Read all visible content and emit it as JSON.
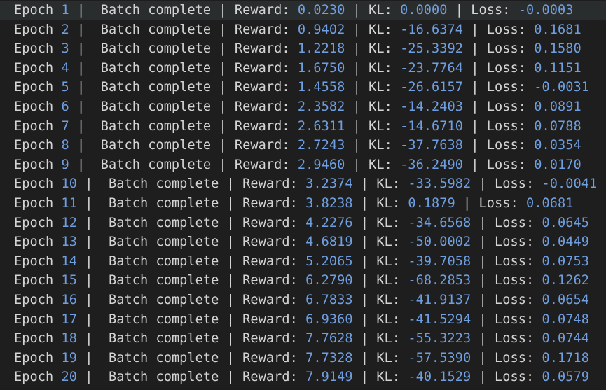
{
  "terminal": {
    "labels": {
      "epoch": "Epoch",
      "batch": "Batch complete",
      "reward": "Reward:",
      "kl": "KL:",
      "loss": "Loss:",
      "sep": "|"
    },
    "colors": {
      "background": "#1e1e1e",
      "text": "#d4d4d4",
      "number": "#6f9fe0",
      "highlight_row": "#2a2d2e"
    },
    "rows": [
      {
        "epoch": "1",
        "reward": "0.0230",
        "kl": "0.0000",
        "loss": "-0.0003"
      },
      {
        "epoch": "2",
        "reward": "0.9402",
        "kl": "-16.6374",
        "loss": "0.1681"
      },
      {
        "epoch": "3",
        "reward": "1.2218",
        "kl": "-25.3392",
        "loss": "0.1580"
      },
      {
        "epoch": "4",
        "reward": "1.6750",
        "kl": "-23.7764",
        "loss": "0.1151"
      },
      {
        "epoch": "5",
        "reward": "1.4558",
        "kl": "-26.6157",
        "loss": "-0.0031"
      },
      {
        "epoch": "6",
        "reward": "2.3582",
        "kl": "-14.2403",
        "loss": "0.0891"
      },
      {
        "epoch": "7",
        "reward": "2.6311",
        "kl": "-14.6710",
        "loss": "0.0788"
      },
      {
        "epoch": "8",
        "reward": "2.7243",
        "kl": "-37.7638",
        "loss": "0.0354"
      },
      {
        "epoch": "9",
        "reward": "2.9460",
        "kl": "-36.2490",
        "loss": "0.0170"
      },
      {
        "epoch": "10",
        "reward": "3.2374",
        "kl": "-33.5982",
        "loss": "-0.0041"
      },
      {
        "epoch": "11",
        "reward": "3.8238",
        "kl": "0.1879",
        "loss": "0.0681"
      },
      {
        "epoch": "12",
        "reward": "4.2276",
        "kl": "-34.6568",
        "loss": "0.0645"
      },
      {
        "epoch": "13",
        "reward": "4.6819",
        "kl": "-50.0002",
        "loss": "0.0449"
      },
      {
        "epoch": "14",
        "reward": "5.2065",
        "kl": "-39.7058",
        "loss": "0.0753"
      },
      {
        "epoch": "15",
        "reward": "6.2790",
        "kl": "-68.2853",
        "loss": "0.1262"
      },
      {
        "epoch": "16",
        "reward": "6.7833",
        "kl": "-41.9137",
        "loss": "0.0654"
      },
      {
        "epoch": "17",
        "reward": "6.9360",
        "kl": "-41.5294",
        "loss": "0.0748"
      },
      {
        "epoch": "18",
        "reward": "7.7628",
        "kl": "-55.3223",
        "loss": "0.0744"
      },
      {
        "epoch": "19",
        "reward": "7.7328",
        "kl": "-57.5390",
        "loss": "0.1718"
      },
      {
        "epoch": "20",
        "reward": "7.9149",
        "kl": "-40.1529",
        "loss": "0.0579"
      }
    ]
  }
}
